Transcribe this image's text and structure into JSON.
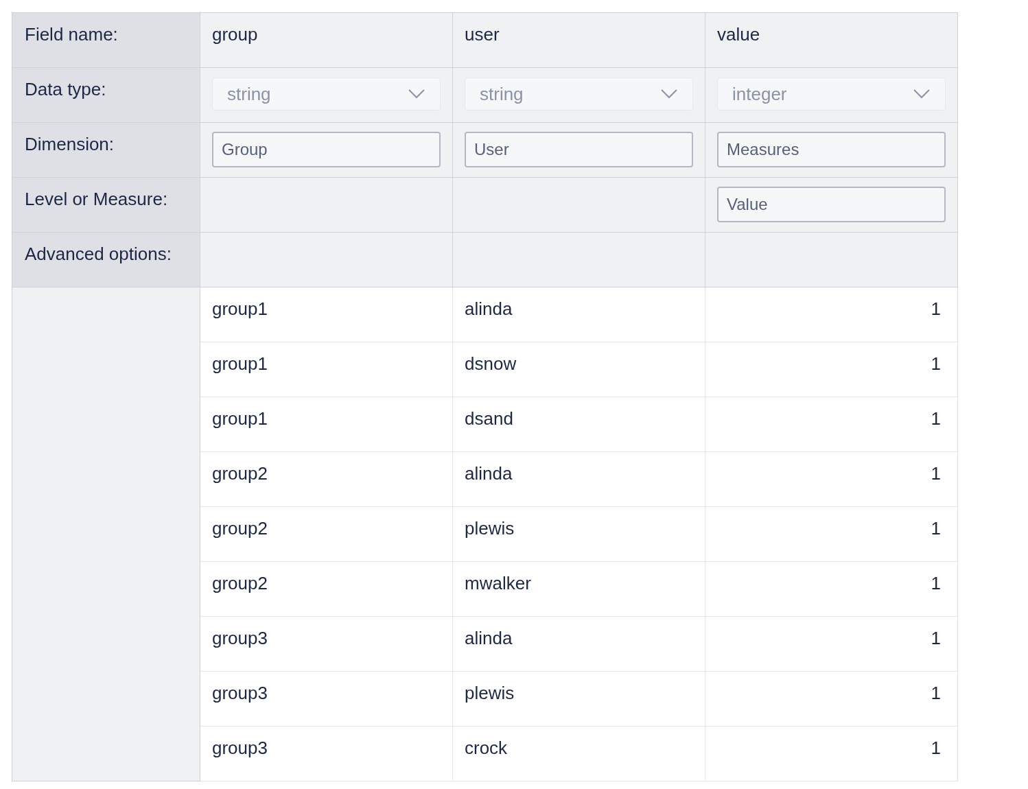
{
  "header_rows": [
    {
      "label": "Field name:",
      "kind": "text",
      "cells": [
        {
          "text": "group"
        },
        {
          "text": "user"
        },
        {
          "text": "value"
        }
      ]
    },
    {
      "label": "Data type:",
      "kind": "select",
      "cells": [
        {
          "value": "string",
          "disabled": true
        },
        {
          "value": "string",
          "disabled": true
        },
        {
          "value": "integer",
          "disabled": true
        }
      ]
    },
    {
      "label": "Dimension:",
      "kind": "input",
      "cells": [
        {
          "value": "Group"
        },
        {
          "value": "User"
        },
        {
          "value": "Measures"
        }
      ]
    },
    {
      "label": "Level or Measure:",
      "kind": "input",
      "cells": [
        null,
        null,
        {
          "value": "Value"
        }
      ]
    },
    {
      "label": "Advanced options:"
    }
  ],
  "rows": [
    [
      "group1",
      "alinda",
      "1"
    ],
    [
      "group1",
      "dsnow",
      "1"
    ],
    [
      "group1",
      "dsand",
      "1"
    ],
    [
      "group2",
      "alinda",
      "1"
    ],
    [
      "group2",
      "plewis",
      "1"
    ],
    [
      "group2",
      "mwalker",
      "1"
    ],
    [
      "group3",
      "alinda",
      "1"
    ],
    [
      "group3",
      "plewis",
      "1"
    ],
    [
      "group3",
      "crock",
      "1"
    ]
  ]
}
